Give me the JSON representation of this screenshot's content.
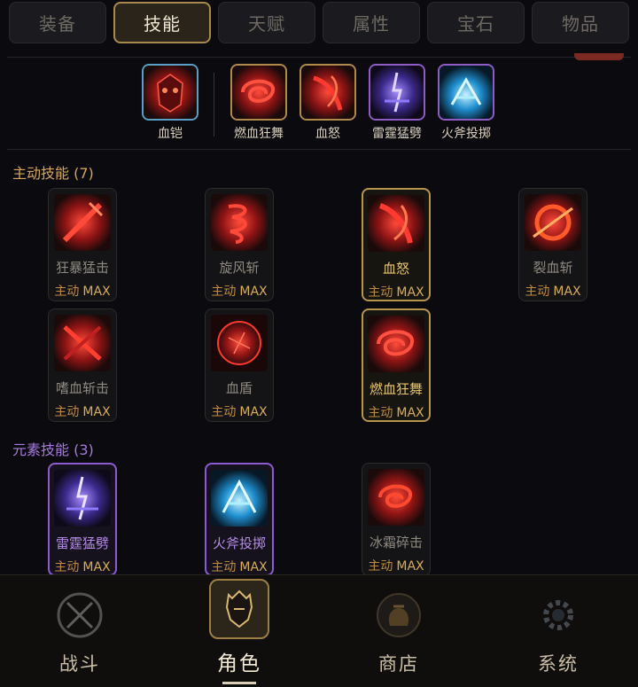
{
  "tabs": [
    {
      "label": "装备",
      "active": false
    },
    {
      "label": "技能",
      "active": true
    },
    {
      "label": "天赋",
      "active": false
    },
    {
      "label": "属性",
      "active": false
    },
    {
      "label": "宝石",
      "active": false
    },
    {
      "label": "物品",
      "active": false
    }
  ],
  "equipped": [
    {
      "label": "血铠",
      "icon": "blood-armor-icon"
    },
    {
      "label": "燃血狂舞",
      "icon": "burning-blood-dance-icon"
    },
    {
      "label": "血怒",
      "icon": "blood-rage-icon"
    },
    {
      "label": "雷霆猛劈",
      "icon": "thunder-cleave-icon"
    },
    {
      "label": "火斧投掷",
      "icon": "fire-axe-throw-icon"
    }
  ],
  "sections": {
    "active": {
      "title": "主动技能 (7)"
    },
    "element": {
      "title": "元素技能 (3)"
    }
  },
  "active_skills": [
    {
      "name": "狂暴猛击",
      "type": "主动",
      "level": "MAX",
      "icon": "berserk-strike-icon"
    },
    {
      "name": "旋风斩",
      "type": "主动",
      "level": "MAX",
      "icon": "whirlwind-slash-icon"
    },
    {
      "name": "血怒",
      "type": "主动",
      "level": "MAX",
      "icon": "blood-rage-icon"
    },
    {
      "name": "裂血斩",
      "type": "主动",
      "level": "MAX",
      "icon": "split-blood-slash-icon"
    },
    {
      "name": "嗜血斩击",
      "type": "主动",
      "level": "MAX",
      "icon": "bloodthirst-slash-icon"
    },
    {
      "name": "血盾",
      "type": "主动",
      "level": "MAX",
      "icon": "blood-shield-icon"
    },
    {
      "name": "燃血狂舞",
      "type": "主动",
      "level": "MAX",
      "icon": "burning-blood-dance-icon"
    }
  ],
  "element_skills": [
    {
      "name": "雷霆猛劈",
      "type": "主动",
      "level": "MAX",
      "icon": "thunder-cleave-icon"
    },
    {
      "name": "火斧投掷",
      "type": "主动",
      "level": "MAX",
      "icon": "fire-axe-throw-icon"
    },
    {
      "name": "冰霜碎击",
      "type": "主动",
      "level": "MAX",
      "icon": "frost-shatter-icon"
    }
  ],
  "nav": [
    {
      "label": "战斗",
      "icon": "crossed-swords-icon",
      "active": false
    },
    {
      "label": "角色",
      "icon": "warrior-helmet-icon",
      "active": true
    },
    {
      "label": "商店",
      "icon": "gold-sack-icon",
      "active": false
    },
    {
      "label": "系统",
      "icon": "gear-icon",
      "active": false
    }
  ],
  "colors": {
    "gold": "#b8954d",
    "purple": "#8d5bd0",
    "blood": "#c4262a",
    "ice": "#4fc0f0"
  }
}
